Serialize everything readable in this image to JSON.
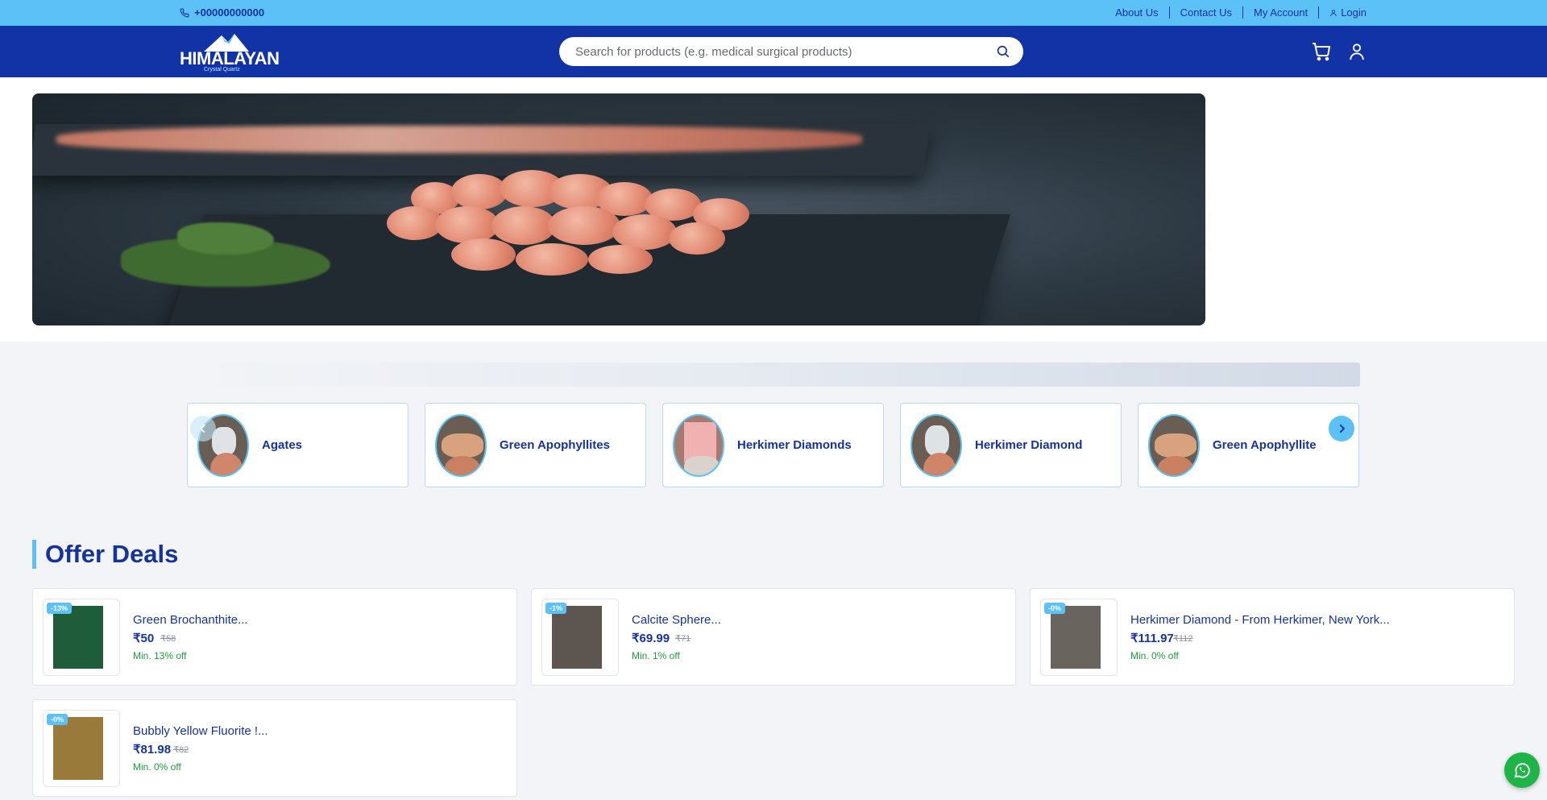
{
  "topbar": {
    "phone": "+00000000000",
    "links": [
      "About Us",
      "Contact Us",
      "My Account",
      "Login"
    ]
  },
  "header": {
    "brand": "HIMALAYAN",
    "brand_sub": "Crystal Quartz",
    "search_placeholder": "Search for products (e.g. medical surgical products)"
  },
  "categories": [
    {
      "label": "Agates"
    },
    {
      "label": "Green Apophyllites"
    },
    {
      "label": "Herkimer Diamonds"
    },
    {
      "label": "Herkimer Diamond"
    },
    {
      "label": "Green Apophyllite"
    }
  ],
  "offers": {
    "title": "Offer Deals",
    "items": [
      {
        "badge": "-13%",
        "name": "Green Brochanthite...",
        "price": "₹50",
        "old_price": "₹58",
        "min_off": "Min. 13% off"
      },
      {
        "badge": "-1%",
        "name": "Calcite Sphere...",
        "price": "₹69.99",
        "old_price": "₹71",
        "min_off": "Min. 1% off"
      },
      {
        "badge": "-0%",
        "name": "Herkimer Diamond - From Herkimer, New York...",
        "price": "₹111.97",
        "old_price": "₹112",
        "min_off": "Min. 0% off"
      },
      {
        "badge": "-0%",
        "name": "Bubbly Yellow Fluorite !...",
        "price": "₹81.98",
        "old_price": "₹82",
        "min_off": "Min. 0% off"
      }
    ]
  },
  "colors": {
    "topbar": "#5bc1f7",
    "header": "#1233a6",
    "accent": "#5bc1f7",
    "text_primary": "#16329c",
    "discount_green": "#1f9d3a",
    "whatsapp": "#1fb447"
  },
  "icons": {
    "phone": "phone-icon",
    "user_small": "user-icon",
    "search": "search-icon",
    "cart": "cart-icon",
    "account": "account-icon",
    "prev": "chevron-left-icon",
    "next": "chevron-right-icon",
    "whatsapp": "whatsapp-icon"
  }
}
